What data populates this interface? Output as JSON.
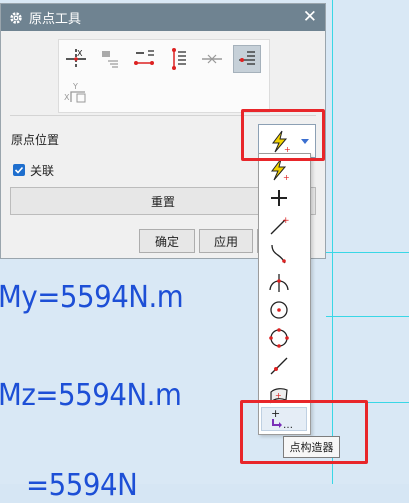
{
  "background": {
    "labels": [
      "My=5594N.m",
      "Mz=5594N.m",
      "=5594N"
    ]
  },
  "dialog": {
    "title": "原点工具",
    "close_label": "✕",
    "origin_position_label": "原点位置",
    "associative_label": "关联",
    "associative_checked": true,
    "reset_label": "重置",
    "ok_label": "确定",
    "apply_label": "应用"
  },
  "tools": [
    {
      "icon": "dynamic-origin-icon",
      "selected": false
    },
    {
      "icon": "move-to-origin-icon",
      "selected": false
    },
    {
      "icon": "align-horizontal-icon",
      "selected": false
    },
    {
      "icon": "align-vertical-icon",
      "selected": false
    },
    {
      "icon": "point-on-line-icon",
      "selected": false
    },
    {
      "icon": "attach-origin-icon",
      "selected": true
    },
    {
      "icon": "alternate-origin-icon",
      "selected": false
    }
  ],
  "dropdown": {
    "selected_icon": "inferred-point-icon",
    "items": [
      "inferred-point-icon",
      "cursor-location-icon",
      "existing-point-icon",
      "end-point-icon",
      "control-point-icon",
      "intersection-point-icon",
      "arc-center-icon",
      "quadrant-point-icon",
      "point-on-curve-icon",
      "point-on-face-icon",
      "point-constructor-icon"
    ],
    "builder_tooltip": "点构造器"
  },
  "colors": {
    "titlebar": "#6f8391",
    "accent_blue": "#1f6fce",
    "highlight_red": "#e8262a",
    "cad_text": "#1d4fd6"
  }
}
